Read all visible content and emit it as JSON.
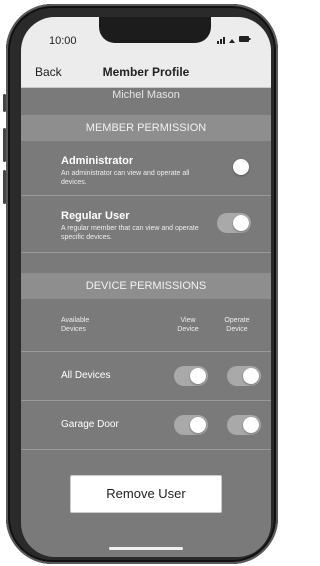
{
  "status": {
    "time": "10:00",
    "icons": "..il ᯤ ▬"
  },
  "nav": {
    "back_label": "Back",
    "title": "Member Profile"
  },
  "member": {
    "name": "Michel Mason"
  },
  "member_permission": {
    "header": "MEMBER PERMISSION",
    "roles": [
      {
        "title": "Administrator",
        "description": "An administrator can view and operate all devices.",
        "selected": false
      },
      {
        "title": "Regular User",
        "description": "A regular member that can view and operate specific devices.",
        "selected": true
      }
    ]
  },
  "device_permissions": {
    "header": "DEVICE PERMISSIONS",
    "columns": {
      "devices": "Available Devices",
      "view": "View Device",
      "operate": "Operate Device"
    },
    "devices": [
      {
        "name": "All Devices",
        "view": true,
        "operate": true
      },
      {
        "name": "Garage Door",
        "view": true,
        "operate": true
      }
    ]
  },
  "remove_button_label": "Remove User"
}
